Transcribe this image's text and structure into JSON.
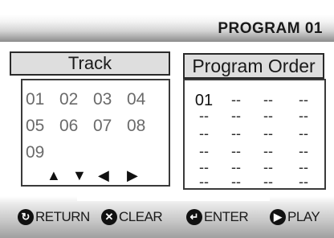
{
  "header": {
    "title": "PROGRAM  01"
  },
  "track_panel": {
    "title": "Track",
    "tracks": [
      "01",
      "02",
      "03",
      "04",
      "05",
      "06",
      "07",
      "08",
      "09"
    ],
    "arrows": [
      "▲",
      "▼",
      "◀",
      "▶"
    ]
  },
  "order_panel": {
    "title": "Program Order",
    "rows": [
      [
        "01",
        "--",
        "--",
        "--"
      ],
      [
        "--",
        "--",
        "--",
        "--"
      ],
      [
        "--",
        "--",
        "--",
        "--"
      ],
      [
        "--",
        "--",
        "--",
        "--"
      ],
      [
        "--",
        "--",
        "--",
        "--"
      ],
      [
        "--",
        "--",
        "--",
        "--"
      ]
    ]
  },
  "footer": {
    "return_label": "RETURN",
    "clear_label": "CLEAR",
    "enter_label": "ENTER",
    "play_label": "PLAY"
  }
}
